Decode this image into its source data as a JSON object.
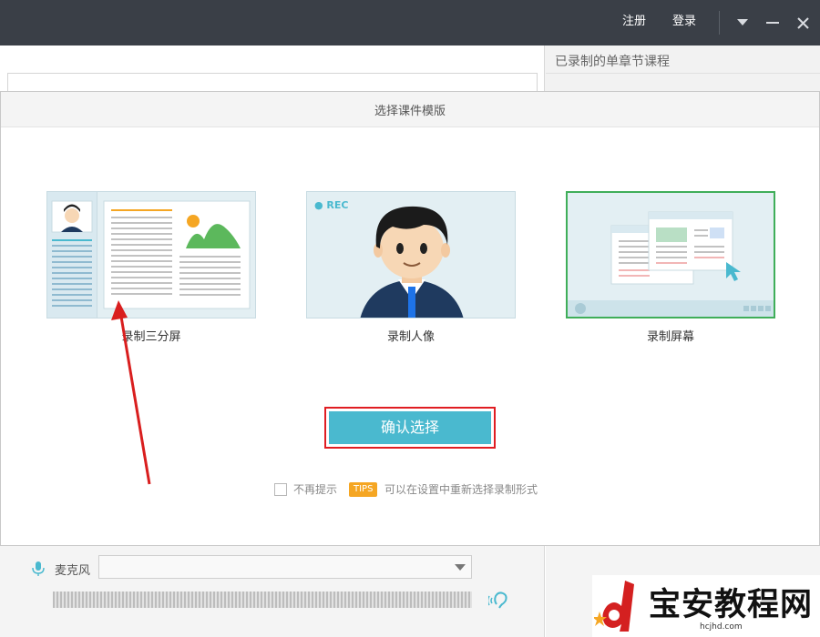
{
  "titlebar": {
    "register_label": "注册",
    "login_label": "登录"
  },
  "background": {
    "right_panel_title": "已录制的单章节课程"
  },
  "dialog": {
    "title": "选择课件模版",
    "templates": [
      {
        "label": "录制三分屏",
        "selected": false
      },
      {
        "label": "录制人像",
        "selected": false
      },
      {
        "label": "录制屏幕",
        "selected": true
      }
    ],
    "portrait_rec_text": "● REC",
    "confirm_label": "确认选择",
    "dont_show_label": "不再提示",
    "tips_badge": "TIPS",
    "tips_text": "可以在设置中重新选择录制形式"
  },
  "bottom": {
    "mic_label": "麦克风",
    "mic_selected": ""
  },
  "watermark": {
    "text": "宝安教程网",
    "url": "hcjhd.com"
  },
  "colors": {
    "titlebar": "#3a3f47",
    "accent_button": "#4ab9cf",
    "highlight_red": "#e01d22",
    "selected_green": "#3fae59",
    "tips_orange": "#f5a623"
  }
}
